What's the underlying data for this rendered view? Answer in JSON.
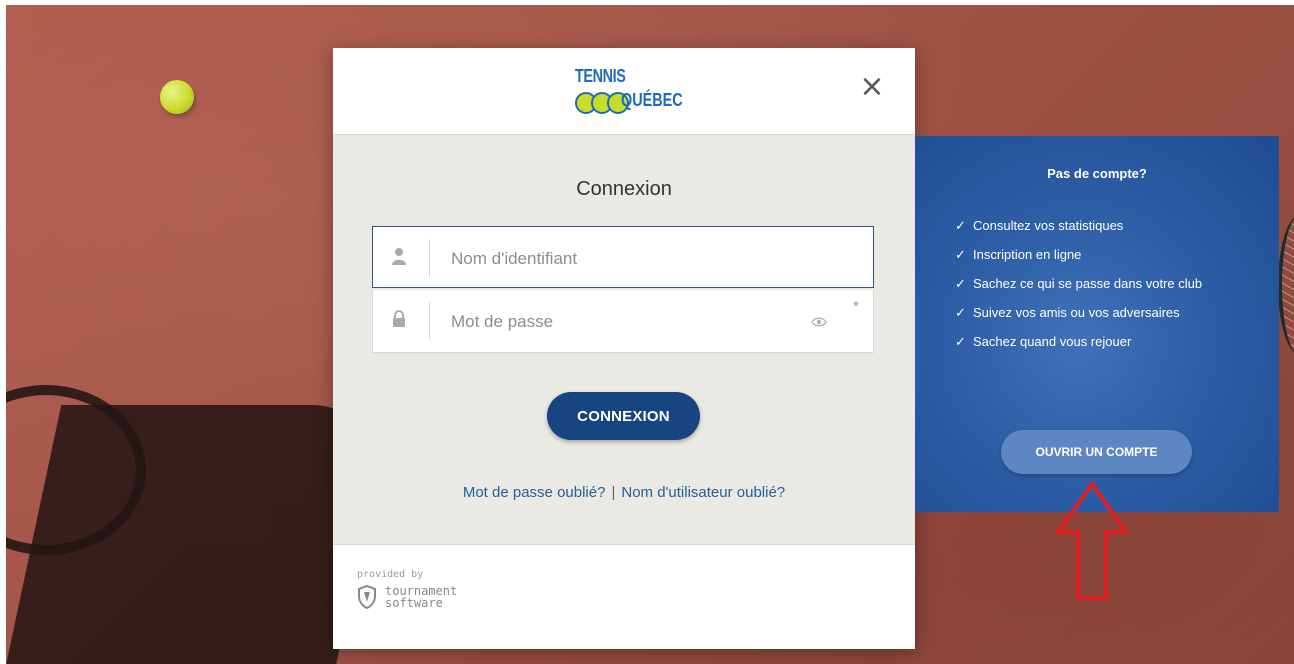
{
  "modal": {
    "logo_top": "TENNIS",
    "logo_bottom": "QUÉBEC",
    "close_symbol": "×",
    "title": "Connexion",
    "username": {
      "placeholder": "Nom d'identifiant",
      "icon": "user-icon"
    },
    "password": {
      "placeholder": "Mot de passe",
      "icon": "lock-icon",
      "required_mark": "*"
    },
    "submit_label": "CONNEXION",
    "forgot_password": "Mot de passe oublié?",
    "separator": "|",
    "forgot_username": "Nom d'utilisateur oublié?",
    "footer": {
      "provided_by": "provided by",
      "brand_line1": "tournament",
      "brand_line2": "software"
    }
  },
  "promo": {
    "title": "Pas de compte?",
    "check": "✓",
    "items": [
      "Consultez vos statistiques",
      "Inscription en ligne",
      "Sachez ce qui se passe dans votre club",
      "Suivez vos amis ou vos adversaires",
      "Sachez quand vous rejouer"
    ],
    "cta_label": "OUVRIR UN COMPTE"
  },
  "colors": {
    "primary": "#17457f",
    "promo_bg": "#2d5ea6",
    "arrow": "#e02020"
  }
}
